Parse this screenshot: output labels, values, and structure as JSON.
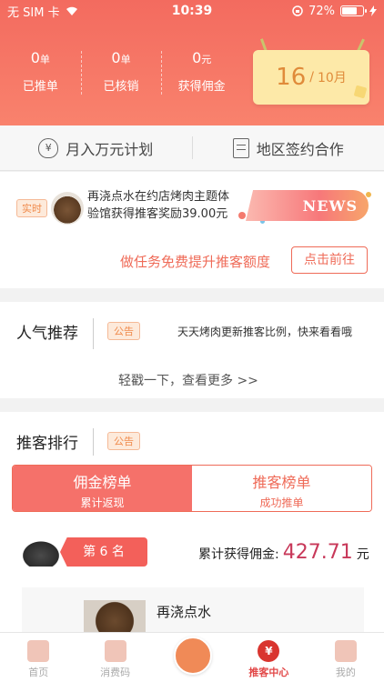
{
  "status_bar": {
    "carrier": "无 SIM 卡",
    "time": "10:39",
    "battery": "72%"
  },
  "stats": [
    {
      "value": "0",
      "unit": "单",
      "label": "已推单"
    },
    {
      "value": "0",
      "unit": "单",
      "label": "已核销"
    },
    {
      "value": "0",
      "unit": "元",
      "label": "获得佣金"
    }
  ],
  "date": {
    "day": "16",
    "month": "10月"
  },
  "plan_bar": {
    "left": "月入万元计划",
    "right": "地区签约合作"
  },
  "news": {
    "realtime_tag": "实时",
    "text": "再浇点水在约店烤肉主题体验馆获得推客奖励39.00元",
    "banner": "NEWS",
    "task": "做任务免费提升推客额度",
    "go_button": "点击前往"
  },
  "popular": {
    "title": "人气推荐",
    "tag": "公告",
    "notice": "天天烤肉更新推客比例，快来看看哦",
    "more": "轻戳一下，查看更多 >>"
  },
  "ranking": {
    "title": "推客排行",
    "tag": "公告",
    "tabs": [
      {
        "title": "佣金榜单",
        "subtitle": "累计返现"
      },
      {
        "title": "推客榜单",
        "subtitle": "成功推单"
      }
    ],
    "rank": "第 6 名",
    "earn_label": "累计获得佣金:",
    "earn_amount": "427.71",
    "earn_unit": "元",
    "user_name": "再浇点水"
  },
  "tabbar": [
    {
      "label": "首页"
    },
    {
      "label": "消费码"
    },
    {
      "label": ""
    },
    {
      "label": "推客中心",
      "icon_text": "¥"
    },
    {
      "label": "我的"
    }
  ]
}
